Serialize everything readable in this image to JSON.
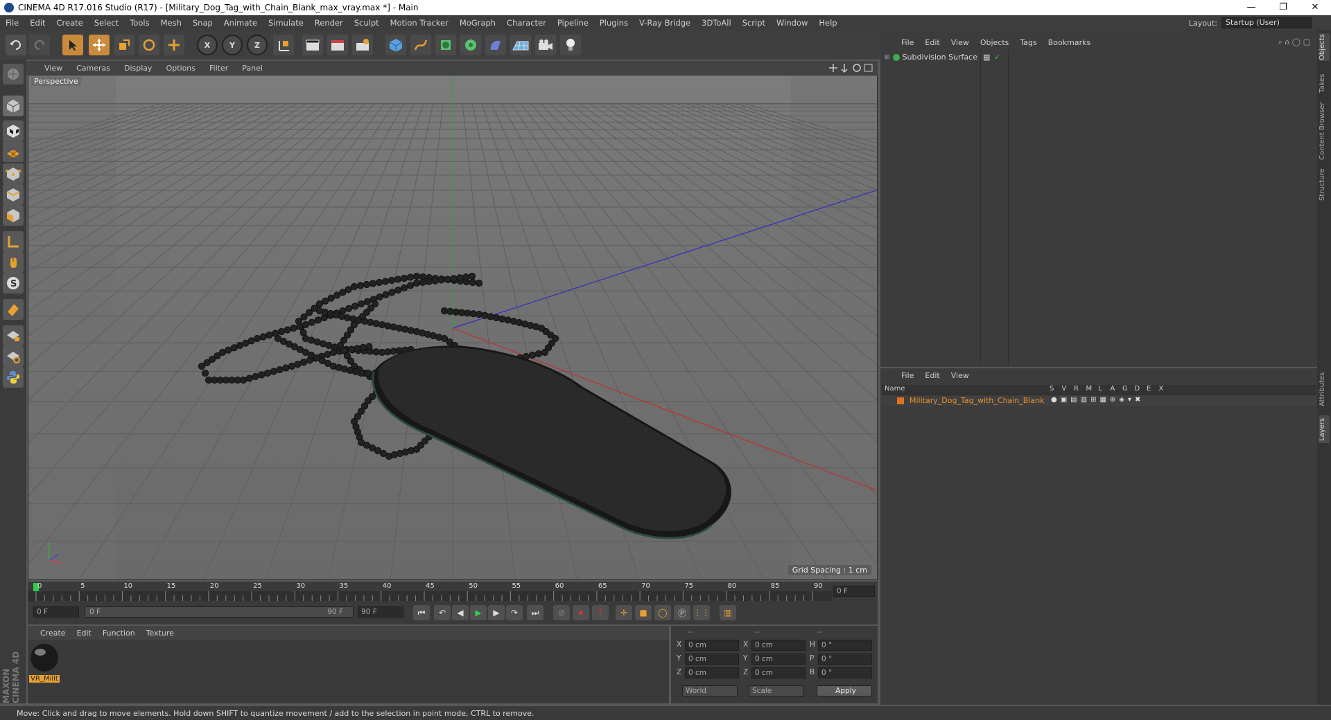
{
  "window": {
    "title": "CINEMA 4D R17.016 Studio (R17) - [Military_Dog_Tag_with_Chain_Blank_max_vray.max *] - Main",
    "minimize": "—",
    "restore": "❐",
    "close": "✕"
  },
  "menubar": [
    "File",
    "Edit",
    "Create",
    "Select",
    "Tools",
    "Mesh",
    "Snap",
    "Animate",
    "Simulate",
    "Render",
    "Sculpt",
    "Motion Tracker",
    "MoGraph",
    "Character",
    "Pipeline",
    "Plugins",
    "V-Ray Bridge",
    "3DToAll",
    "Script",
    "Window",
    "Help"
  ],
  "layout": {
    "label": "Layout:",
    "value": "Startup (User)"
  },
  "toolbar": {
    "undo": "undo-icon",
    "redo": "redo-icon",
    "axis_x": "X",
    "axis_y": "Y",
    "axis_z": "Z"
  },
  "viewport": {
    "menu": [
      "View",
      "Cameras",
      "Display",
      "Options",
      "Filter",
      "Panel"
    ],
    "camera_label": "Perspective",
    "grid_spacing": "Grid Spacing : 1 cm"
  },
  "timeline": {
    "ticks": [
      "0",
      "5",
      "10",
      "15",
      "20",
      "25",
      "30",
      "35",
      "40",
      "45",
      "50",
      "55",
      "60",
      "65",
      "70",
      "75",
      "80",
      "85",
      "90"
    ],
    "current_frame": "0 F",
    "start_field": "0 F",
    "range_start": "0 F",
    "range_end": "90 F",
    "end_field": "90 F"
  },
  "material": {
    "menu": [
      "Create",
      "Edit",
      "Function",
      "Texture"
    ],
    "items": [
      {
        "name": "VR_Milit"
      }
    ]
  },
  "coords": {
    "headers": [
      "--",
      "--",
      "--"
    ],
    "rows": [
      {
        "a": "X",
        "av": "0 cm",
        "b": "X",
        "bv": "0 cm",
        "c": "H",
        "cv": "0 °"
      },
      {
        "a": "Y",
        "av": "0 cm",
        "b": "Y",
        "bv": "0 cm",
        "c": "P",
        "cv": "0 °"
      },
      {
        "a": "Z",
        "av": "0 cm",
        "b": "Z",
        "bv": "0 cm",
        "c": "B",
        "cv": "0 °"
      }
    ],
    "mode1": "World",
    "mode2": "Scale",
    "apply": "Apply"
  },
  "objects_panel": {
    "menu": [
      "File",
      "Edit",
      "View",
      "Objects",
      "Tags",
      "Bookmarks"
    ],
    "items": [
      {
        "name": "Subdivision Surface"
      }
    ]
  },
  "layers_panel": {
    "menu": [
      "File",
      "Edit",
      "View"
    ],
    "columns": [
      "Name",
      "S",
      "V",
      "R",
      "M",
      "L",
      "A",
      "G",
      "D",
      "E",
      "X"
    ],
    "items": [
      {
        "name": "Military_Dog_Tag_with_Chain_Blank",
        "color": "#e07020"
      }
    ]
  },
  "side_tabs": [
    "Objects",
    "Takes",
    "Content Browser",
    "Structure",
    "Attributes",
    "Layers"
  ],
  "status": "Move: Click and drag to move elements. Hold down SHIFT to quantize movement / add to the selection in point mode, CTRL to remove.",
  "brand": "MAXON CINEMA 4D"
}
